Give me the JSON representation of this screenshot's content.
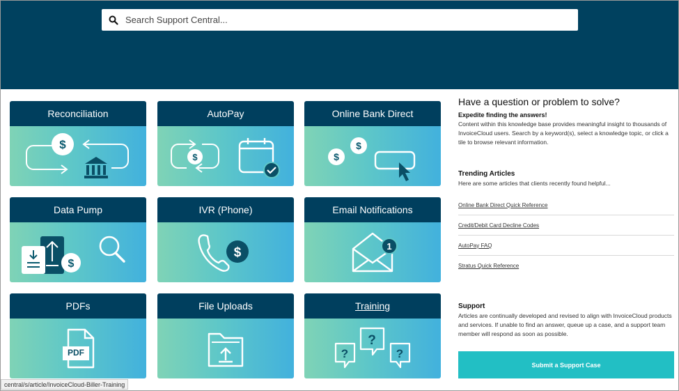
{
  "search": {
    "placeholder": "Search Support Central..."
  },
  "tiles": [
    {
      "label": "Reconciliation"
    },
    {
      "label": "AutoPay"
    },
    {
      "label": "Online Bank Direct"
    },
    {
      "label": "Data Pump"
    },
    {
      "label": "IVR (Phone)"
    },
    {
      "label": "Email Notifications"
    },
    {
      "label": "PDFs",
      "icon_text": "PDF"
    },
    {
      "label": "File Uploads"
    },
    {
      "label": "Training"
    }
  ],
  "intro": {
    "title": "Have a question or problem to solve?",
    "subtitle": "Expedite finding the answers!",
    "text": "Content within this knowledge base provides meaningful insight to thousands of InvoiceCloud users.  Search by a keyword(s), select a knowledge topic, or click a tile to browse relevant information."
  },
  "trending": {
    "title": "Trending Articles",
    "text": "Here are some articles that clients recently found helpful...",
    "links": [
      "Online Bank Direct Quick Reference",
      "Credit/Debit Card Decline Codes",
      "AutoPay FAQ",
      "Stratus Quick Reference"
    ]
  },
  "support": {
    "title": "Support",
    "text": "Articles are continually developed and revised to align with InvoiceCloud products and services.  If unable to find an answer, queue up a case, and a support team member will respond as soon as possible.",
    "button": "Submit a Support Case"
  },
  "status_bar": "central/s/article/InvoiceCloud-Biller-Training",
  "colors": {
    "header": "#00415f",
    "tile_head": "#003f5e",
    "accent": "#22bfc4"
  },
  "icons": [
    "search-icon",
    "dollar-icon",
    "bank-icon",
    "calendar-check-icon",
    "cursor-icon",
    "document-upload-icon",
    "magnifier-icon",
    "phone-icon",
    "envelope-icon",
    "pdf-icon",
    "folder-upload-icon",
    "question-bubble-icon"
  ]
}
